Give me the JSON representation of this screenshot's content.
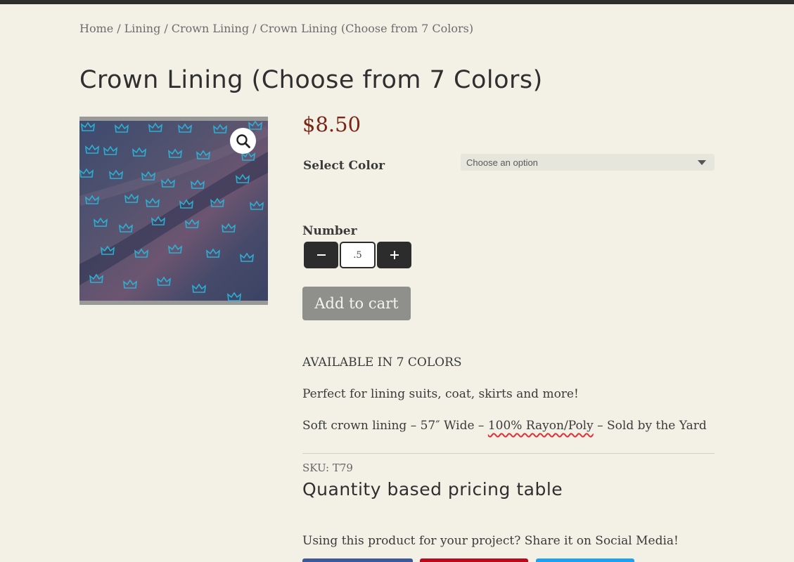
{
  "breadcrumb": {
    "items": [
      "Home",
      "Lining",
      "Crown Lining"
    ],
    "current": "Crown Lining (Choose from 7 Colors)",
    "separator": "/"
  },
  "product": {
    "title": "Crown Lining (Choose from 7 Colors)",
    "price": "$8.50",
    "image_alt": "Crown Lining"
  },
  "variation": {
    "label": "Select Color",
    "selected": "Choose an option"
  },
  "quantity": {
    "label": "Number",
    "value": ".5",
    "minus_icon": "minus-icon",
    "plus_icon": "plus-icon"
  },
  "add_to_cart_label": "Add to cart",
  "description": {
    "line1": "AVAILABLE IN 7 COLORS",
    "line2": "Perfect for lining suits, coat, skirts and more!",
    "line3_before": "Soft crown lining – 57″ Wide – ",
    "line3_highlight": "100% Rayon/Poly",
    "line3_after": " – Sold by the Yard"
  },
  "sku": "SKU: T79",
  "pricing_table_heading": "Quantity based pricing table",
  "share_text": "Using this product for your project? Share it on Social Media!",
  "colors": {
    "price": "#7a2515",
    "topbar": "#2e2e2e",
    "background": "#f3f1e6",
    "share_facebook": "#3b5998",
    "share_pinterest": "#bd081c",
    "share_twitter": "#1da1f2"
  }
}
